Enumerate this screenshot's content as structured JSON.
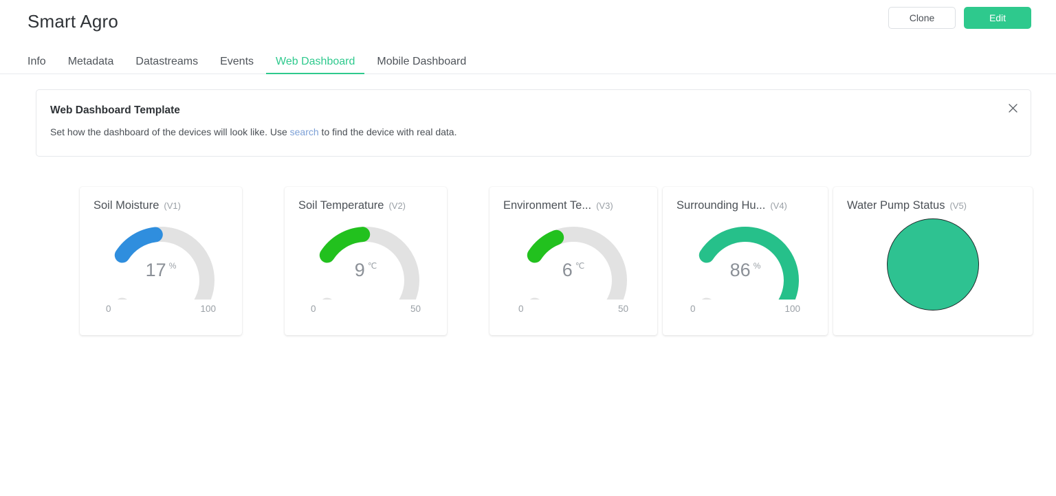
{
  "header": {
    "title": "Smart Agro",
    "clone_label": "Clone",
    "edit_label": "Edit"
  },
  "tabs": [
    {
      "label": "Info",
      "active": false
    },
    {
      "label": "Metadata",
      "active": false
    },
    {
      "label": "Datastreams",
      "active": false
    },
    {
      "label": "Events",
      "active": false
    },
    {
      "label": "Web Dashboard",
      "active": true
    },
    {
      "label": "Mobile Dashboard",
      "active": false
    }
  ],
  "banner": {
    "title": "Web Dashboard Template",
    "text_before": "Set how the dashboard of the devices will look like. Use ",
    "link_text": "search",
    "text_after": " to find the device with real data.",
    "close_icon": "close-icon"
  },
  "colors": {
    "accent": "#2ec98d",
    "gauge_blue": "#2f8ede",
    "gauge_green": "#22c11e",
    "gauge_teal": "#26c08a",
    "gauge_track": "#e2e2e2",
    "status_fill": "#2ec291"
  },
  "chart_data": [
    {
      "type": "gauge",
      "title": "Soil Moisture",
      "pin": "(V1)",
      "value": 17,
      "value_label": "17",
      "unit": "%",
      "min": 0,
      "max": 100,
      "min_label": "0",
      "max_label": "100",
      "color": "#2f8ede",
      "track_color": "#e2e2e2"
    },
    {
      "type": "gauge",
      "title": "Soil Temperature",
      "pin": "(V2)",
      "value": 9,
      "value_label": "9",
      "unit": "℃",
      "min": 0,
      "max": 50,
      "min_label": "0",
      "max_label": "50",
      "color": "#22c11e",
      "track_color": "#e2e2e2"
    },
    {
      "type": "gauge",
      "title": "Environment Te...",
      "title_full": "Environment Temperature",
      "pin": "(V3)",
      "value": 6,
      "value_label": "6",
      "unit": "℃",
      "min": 0,
      "max": 50,
      "min_label": "0",
      "max_label": "50",
      "color": "#22c11e",
      "track_color": "#e2e2e2"
    },
    {
      "type": "gauge",
      "title": "Surrounding Hu...",
      "title_full": "Surrounding Humidity",
      "pin": "(V4)",
      "value": 86,
      "value_label": "86",
      "unit": "%",
      "min": 0,
      "max": 100,
      "min_label": "0",
      "max_label": "100",
      "color": "#26c08a",
      "track_color": "#e2e2e2"
    },
    {
      "type": "status-indicator",
      "title": "Water Pump Status",
      "pin": "(V5)",
      "fill_color": "#2ec291",
      "stroke_color": "#1f2a2a"
    }
  ]
}
